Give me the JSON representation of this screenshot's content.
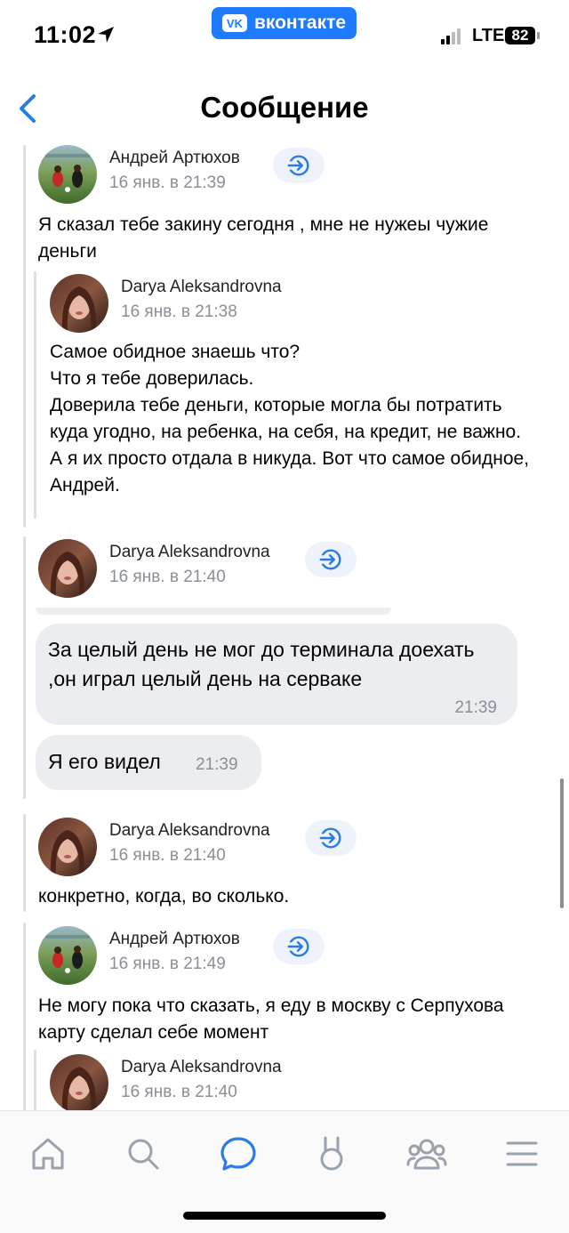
{
  "status": {
    "time": "11:02",
    "app_badge": "вконтакте",
    "network": "LTE",
    "battery": "82"
  },
  "header": {
    "title": "Сообщение"
  },
  "messages": [
    {
      "name": "Андрей Артюхов",
      "date": "16 янв. в 21:39",
      "text": "Я сказал тебе закину сегодня , мне не нужеы чужие деньги"
    },
    {
      "name": "Darya Aleksandrovna",
      "date": "16 янв. в 21:38",
      "text": "Самое обидное знаешь что?\nЧто я тебе доверилась.\nДоверила тебе деньги, которые могла бы потратить куда угодно, на ребенка, на себя, на кредит, не важно.\nА я их просто отдала в никуда. Вот что самое обидное, Андрей."
    },
    {
      "name": "Darya Aleksandrovna",
      "date": "16 янв. в 21:40"
    },
    {
      "name": "Darya Aleksandrovna",
      "date": "16 янв. в 21:40",
      "text": "конкретно, когда, во сколько."
    },
    {
      "name": "Андрей Артюхов",
      "date": "16 янв. в 21:49",
      "text": "Не могу пока что сказать, я еду в москву с Серпухова карту сделал себе момент"
    },
    {
      "name": "Darya Aleksandrovna",
      "date": "16 янв. в 21:40"
    }
  ],
  "bubbles": [
    {
      "text": "За целый день не мог до терминала доехать ,он играл целый день на серваке",
      "time": "21:39"
    },
    {
      "text": "Я его видел",
      "time": "21:39"
    }
  ],
  "tabs": [
    "home-icon",
    "search-icon",
    "messages-icon",
    "clips-icon",
    "friends-icon",
    "menu-icon"
  ],
  "colors": {
    "accent": "#2a7be4",
    "vk_blue": "#1e7bff",
    "bubble": "#ebedf0",
    "secondary_text": "#8a8f96"
  }
}
